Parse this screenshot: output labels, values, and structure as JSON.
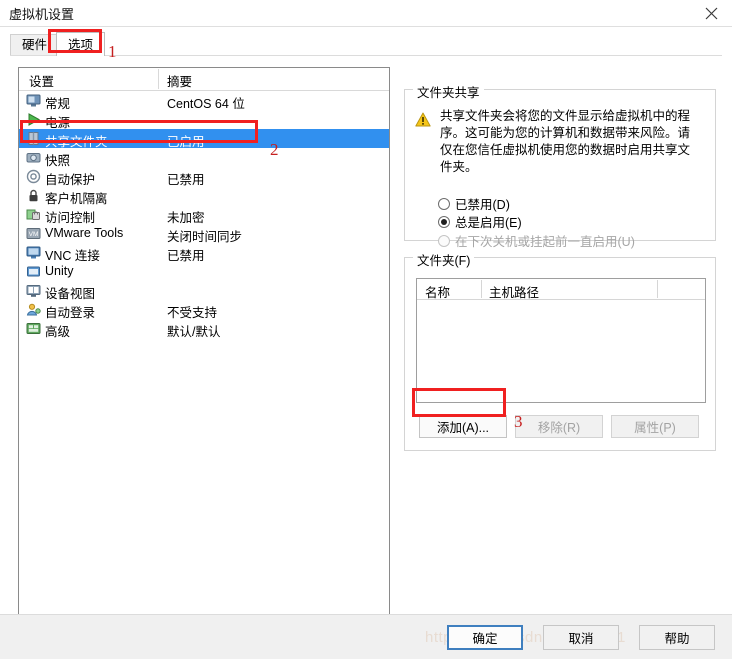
{
  "window": {
    "title": "虚拟机设置",
    "close_label": "✕"
  },
  "tabs": [
    {
      "label": "硬件",
      "active": false
    },
    {
      "label": "选项",
      "active": true
    }
  ],
  "settings_list": {
    "columns": {
      "name": "设置",
      "summary": "摘要"
    },
    "rows": [
      {
        "icon": "monitor-icon",
        "label": "常规",
        "summary": "CentOS 64 位",
        "selected": false
      },
      {
        "icon": "power-icon",
        "label": "电源",
        "summary": "",
        "selected": false
      },
      {
        "icon": "folder-icon",
        "label": "共享文件夹",
        "summary": "已启用",
        "selected": true
      },
      {
        "icon": "camera-icon",
        "label": "快照",
        "summary": "",
        "selected": false
      },
      {
        "icon": "autoprotect-icon",
        "label": "自动保护",
        "summary": "已禁用",
        "selected": false
      },
      {
        "icon": "lock-icon",
        "label": "客户机隔离",
        "summary": "",
        "selected": false
      },
      {
        "icon": "access-icon",
        "label": "访问控制",
        "summary": "未加密",
        "selected": false
      },
      {
        "icon": "vmware-tools-icon",
        "label": "VMware Tools",
        "summary": "关闭时间同步",
        "selected": false
      },
      {
        "icon": "vnc-icon",
        "label": "VNC 连接",
        "summary": "已禁用",
        "selected": false
      },
      {
        "icon": "unity-icon",
        "label": "Unity",
        "summary": "",
        "selected": false
      },
      {
        "icon": "deviceview-icon",
        "label": "设备视图",
        "summary": "",
        "selected": false
      },
      {
        "icon": "autologin-icon",
        "label": "自动登录",
        "summary": "不受支持",
        "selected": false
      },
      {
        "icon": "advanced-icon",
        "label": "高级",
        "summary": "默认/默认",
        "selected": false
      }
    ]
  },
  "sharing_group": {
    "title": "文件夹共享",
    "warning_icon": "warning-icon",
    "warning_text": "共享文件夹会将您的文件显示给虚拟机中的程序。这可能为您的计算机和数据带来风险。请仅在您信任虚拟机使用您的数据时启用共享文件夹。",
    "options": [
      {
        "label": "已禁用(D)",
        "checked": false,
        "disabled": false
      },
      {
        "label": "总是启用(E)",
        "checked": true,
        "disabled": false
      },
      {
        "label": "在下次关机或挂起前一直启用(U)",
        "checked": false,
        "disabled": true
      }
    ]
  },
  "folders_group": {
    "title": "文件夹(F)",
    "columns": [
      "名称",
      "主机路径"
    ],
    "rows": [],
    "buttons": [
      {
        "label": "添加(A)...",
        "disabled": false
      },
      {
        "label": "移除(R)",
        "disabled": true
      },
      {
        "label": "属性(P)",
        "disabled": true
      }
    ]
  },
  "footer": {
    "ok": "确定",
    "cancel": "取消",
    "help": "帮助",
    "watermark": "https://blog.csdn.net/yk3001"
  },
  "annotations": [
    {
      "number": "1"
    },
    {
      "number": "2"
    },
    {
      "number": "3"
    }
  ],
  "colors": {
    "selection_blue": "#3190ef",
    "annotation_red": "#f02020",
    "warning_yellow": "#f5c518",
    "default_button_border": "#3f7fbf"
  }
}
